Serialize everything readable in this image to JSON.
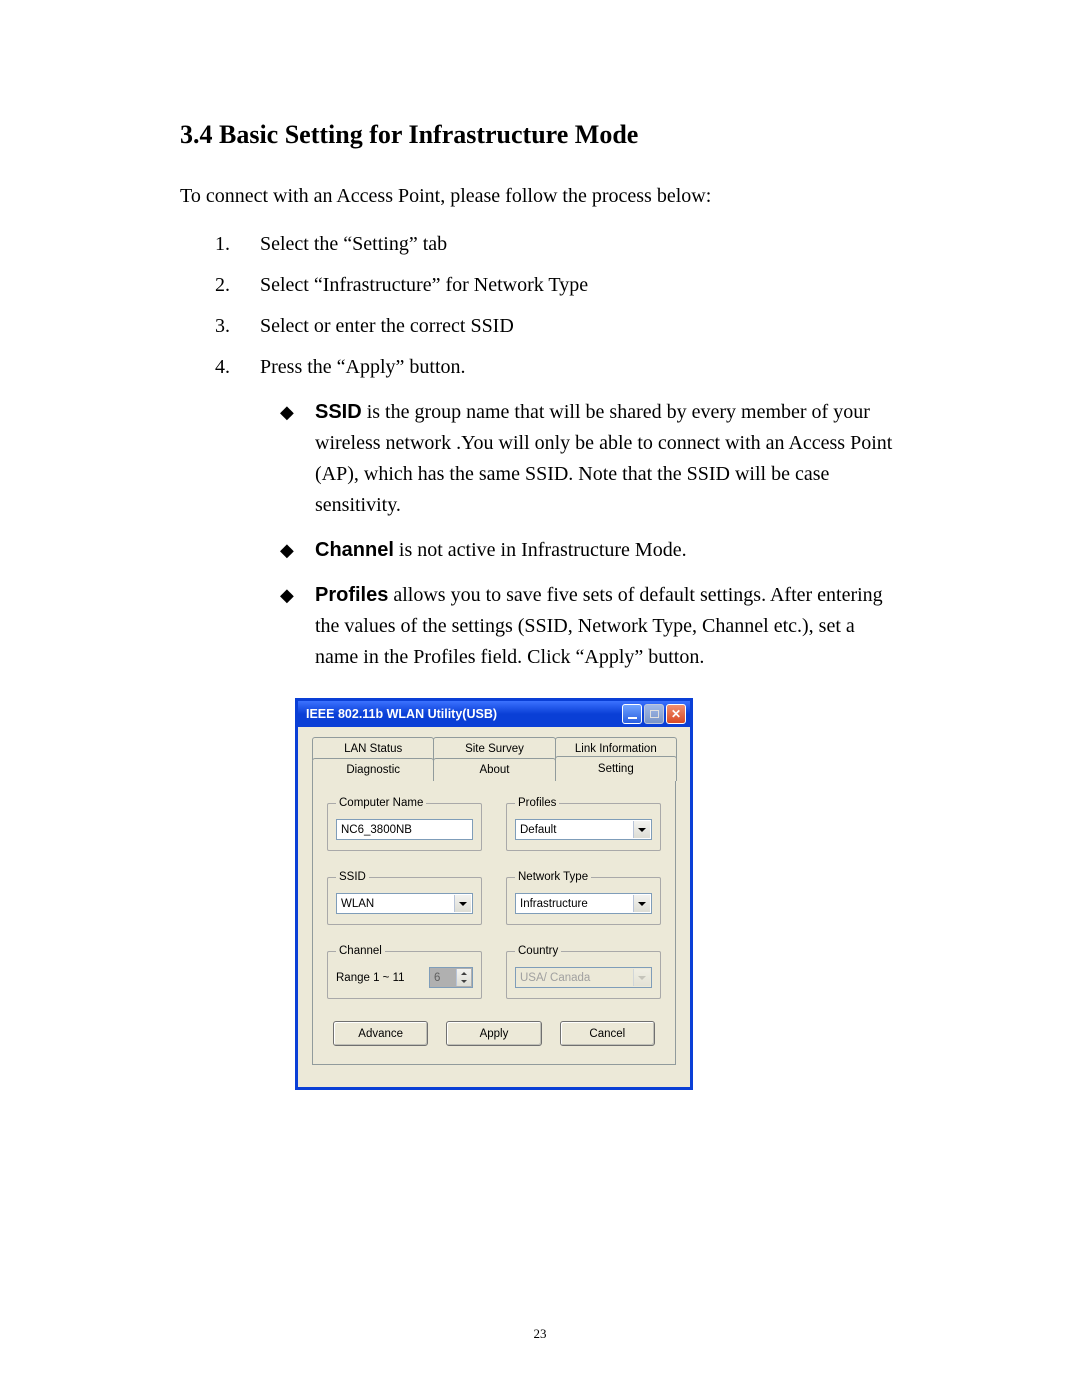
{
  "heading": "3.4 Basic Setting for Infrastructure Mode",
  "intro": "To connect with an Access Point, please follow the process below:",
  "steps": [
    "Select the “Setting” tab",
    "Select “Infrastructure” for Network Type",
    "Select or enter the correct SSID",
    "Press the “Apply” button."
  ],
  "bullets": [
    {
      "label": "SSID",
      "text": " is the group name that will be shared by every member of your wireless network .You will only be able to connect with an Access Point (AP), which has the same SSID. Note that the SSID will be case sensitivity."
    },
    {
      "label": "Channel",
      "text": " is not active in Infrastructure Mode."
    },
    {
      "label": "Profiles",
      "text": " allows you to save five sets of default settings.    After entering the values of the settings (SSID, Network Type, Channel etc.), set a name in the Profiles field.    Click “Apply” button."
    }
  ],
  "page_number": "23",
  "window": {
    "title": "IEEE 802.11b WLAN Utility(USB)",
    "tabs_back": [
      "LAN Status",
      "Site Survey",
      "Link Information"
    ],
    "tabs_front": [
      "Diagnostic",
      "About",
      "Setting"
    ],
    "active_tab": "Setting",
    "groups": {
      "computer_name": {
        "legend": "Computer Name",
        "value": "NC6_3800NB"
      },
      "profiles": {
        "legend": "Profiles",
        "value": "Default"
      },
      "ssid": {
        "legend": "SSID",
        "value": "WLAN"
      },
      "network_type": {
        "legend": "Network Type",
        "value": "Infrastructure"
      },
      "channel": {
        "legend": "Channel",
        "range_label": "Range 1 ~ 11",
        "value": "6"
      },
      "country": {
        "legend": "Country",
        "value": "USA/ Canada"
      }
    },
    "buttons": {
      "advance": "Advance",
      "apply": "Apply",
      "cancel": "Cancel"
    }
  }
}
